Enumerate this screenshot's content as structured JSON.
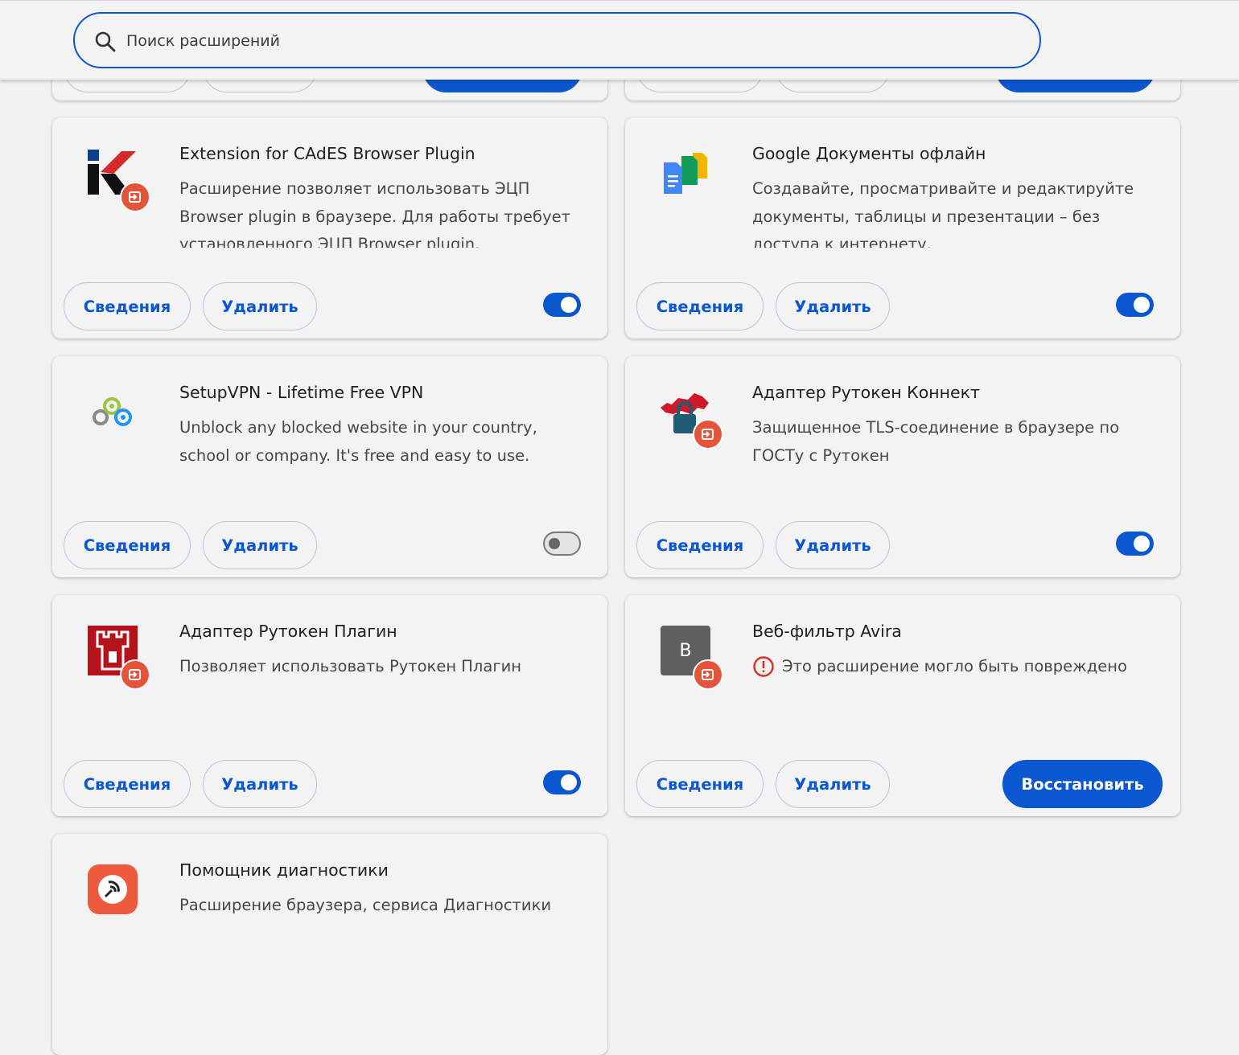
{
  "search": {
    "placeholder": "Поиск расширений"
  },
  "buttons": {
    "details": "Сведения",
    "remove": "Удалить",
    "repair": "Восстановить"
  },
  "extensions": [
    {
      "name": "Extension for CAdES Browser Plugin",
      "description": "Расширение позволяет использовать ЭЦП Browser plugin в браузере. Для работы требует установленного ЭЦП Browser plugin.",
      "icon": "cades-k-icon",
      "enabled": true
    },
    {
      "name": "Google Документы офлайн",
      "description": "Создавайте, просматривайте и редактируйте документы, таблицы и презентации – без доступа к интернету.",
      "icon": "google-docs-icon",
      "enabled": true
    },
    {
      "name": "SetupVPN - Lifetime Free VPN",
      "description": "Unblock any blocked website in your country, school or company. It's free and easy to use.",
      "icon": "setupvpn-icon",
      "enabled": false
    },
    {
      "name": "Адаптер Рутокен Коннект",
      "description": "Защищенное TLS-соединение в браузере по ГОСТу с Рутокен",
      "icon": "rutoken-connect-icon",
      "enabled": true
    },
    {
      "name": "Адаптер Рутокен Плагин",
      "description": "Позволяет использовать Рутокен Плагин",
      "icon": "rutoken-plugin-icon",
      "enabled": true
    },
    {
      "name": "Веб-фильтр Avira",
      "warning": "Это расширение могло быть повреждено",
      "icon_letter": "В",
      "icon": "avira-placeholder-icon",
      "enabled": null
    },
    {
      "name": "Помощник диагностики",
      "description": "Расширение браузера, сервиса Диагностики",
      "icon": "diagnostics-icon"
    }
  ],
  "colors": {
    "accent": "#0b57d0",
    "warning": "#d93025",
    "badge": "#e5533a"
  }
}
